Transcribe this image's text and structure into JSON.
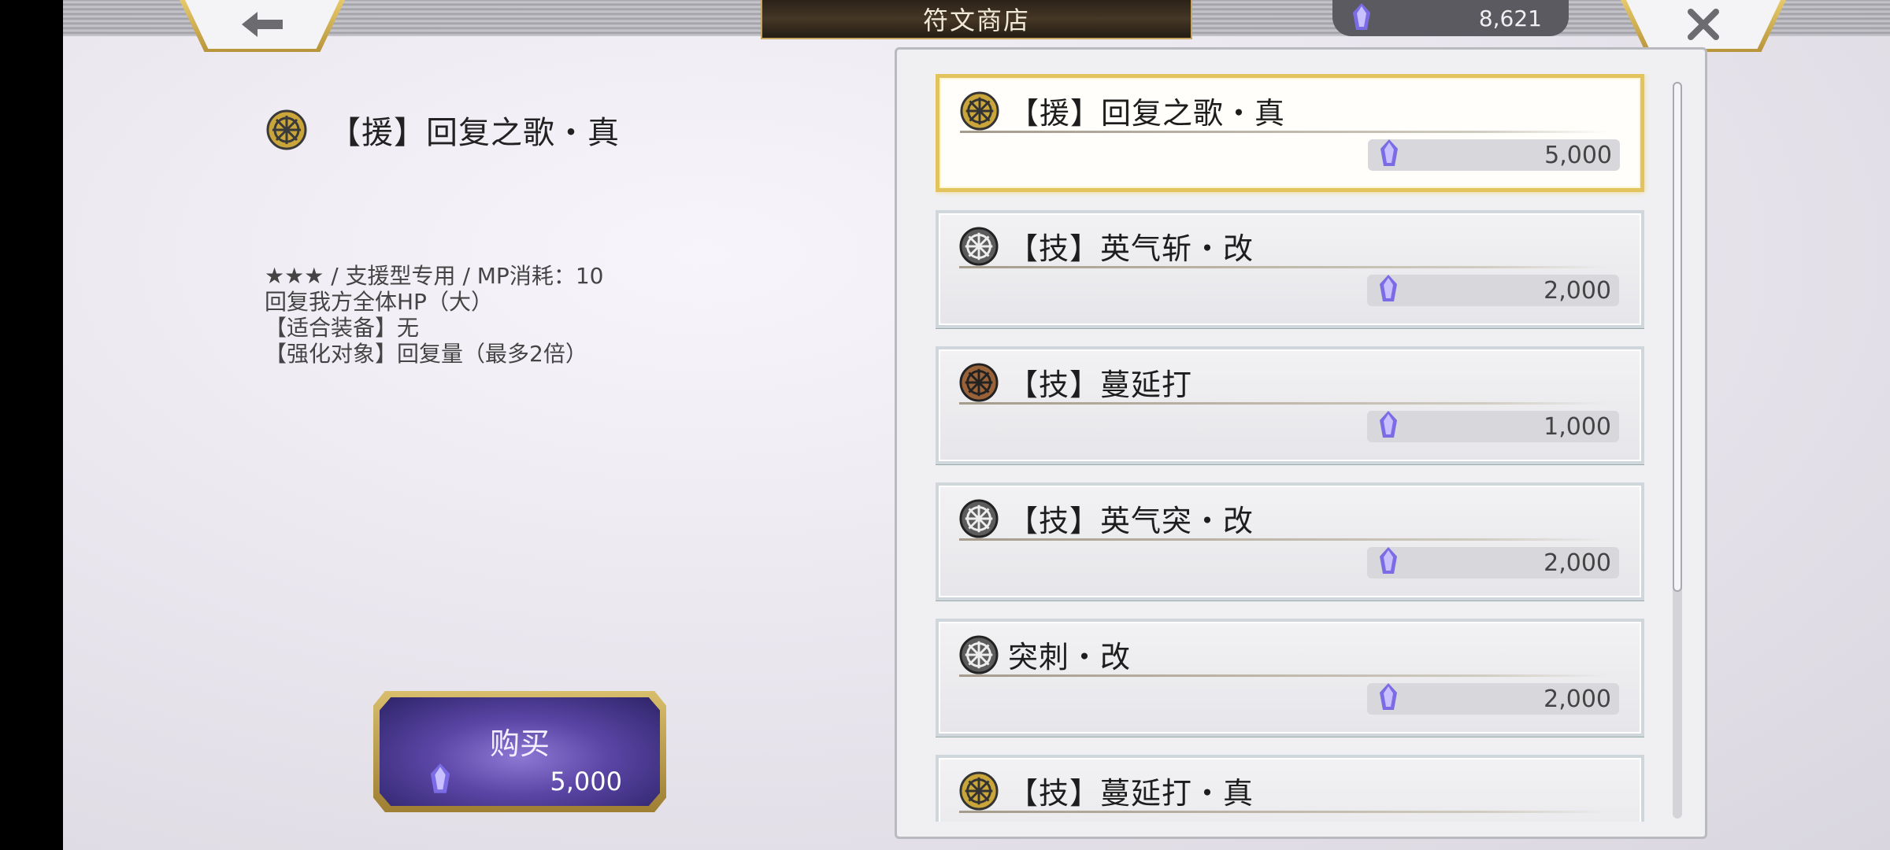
{
  "header": {
    "title": "符文商店",
    "currency_amount": "8,621",
    "back_icon": "arrow-left-icon",
    "close_icon": "close-icon"
  },
  "detail": {
    "name": "【援】回复之歌・真",
    "desc_line1": "★★★ / 支援型专用 / MP消耗：10",
    "desc_line2": "回复我方全体HP（大）",
    "desc_line3": "【适合装备】无",
    "desc_line4": "【强化对象】回复量（最多2倍）"
  },
  "buy": {
    "label": "购买",
    "price": "5,000"
  },
  "items": [
    {
      "label": "【援】回复之歌・真",
      "price": "5,000",
      "icon_color": "#c9a53a"
    },
    {
      "label": "【技】英气斩・改",
      "price": "2,000",
      "icon_color": "#5c5c5c"
    },
    {
      "label": "【技】蔓延打",
      "price": "1,000",
      "icon_color": "#9a6238"
    },
    {
      "label": "【技】英气突・改",
      "price": "2,000",
      "icon_color": "#5c5c5c"
    },
    {
      "label": "突刺・改",
      "price": "2,000",
      "icon_color": "#5c5c5c"
    },
    {
      "label": "【技】蔓延打・真",
      "price": "",
      "icon_color": "#c9a53a"
    }
  ],
  "colors": {
    "gold": "#e3c35e",
    "crystal": "#7b6ce6"
  }
}
